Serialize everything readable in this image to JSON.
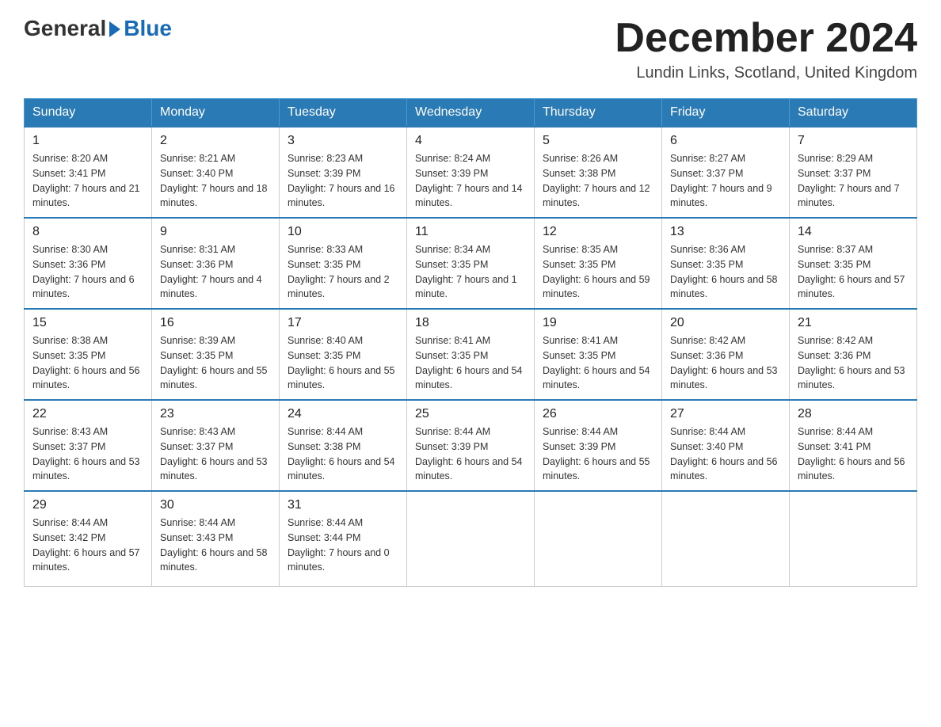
{
  "header": {
    "logo_general": "General",
    "logo_blue": "Blue",
    "title": "December 2024",
    "location": "Lundin Links, Scotland, United Kingdom"
  },
  "weekdays": [
    "Sunday",
    "Monday",
    "Tuesday",
    "Wednesday",
    "Thursday",
    "Friday",
    "Saturday"
  ],
  "weeks": [
    [
      {
        "day": "1",
        "sunrise": "8:20 AM",
        "sunset": "3:41 PM",
        "daylight": "7 hours and 21 minutes."
      },
      {
        "day": "2",
        "sunrise": "8:21 AM",
        "sunset": "3:40 PM",
        "daylight": "7 hours and 18 minutes."
      },
      {
        "day": "3",
        "sunrise": "8:23 AM",
        "sunset": "3:39 PM",
        "daylight": "7 hours and 16 minutes."
      },
      {
        "day": "4",
        "sunrise": "8:24 AM",
        "sunset": "3:39 PM",
        "daylight": "7 hours and 14 minutes."
      },
      {
        "day": "5",
        "sunrise": "8:26 AM",
        "sunset": "3:38 PM",
        "daylight": "7 hours and 12 minutes."
      },
      {
        "day": "6",
        "sunrise": "8:27 AM",
        "sunset": "3:37 PM",
        "daylight": "7 hours and 9 minutes."
      },
      {
        "day": "7",
        "sunrise": "8:29 AM",
        "sunset": "3:37 PM",
        "daylight": "7 hours and 7 minutes."
      }
    ],
    [
      {
        "day": "8",
        "sunrise": "8:30 AM",
        "sunset": "3:36 PM",
        "daylight": "7 hours and 6 minutes."
      },
      {
        "day": "9",
        "sunrise": "8:31 AM",
        "sunset": "3:36 PM",
        "daylight": "7 hours and 4 minutes."
      },
      {
        "day": "10",
        "sunrise": "8:33 AM",
        "sunset": "3:35 PM",
        "daylight": "7 hours and 2 minutes."
      },
      {
        "day": "11",
        "sunrise": "8:34 AM",
        "sunset": "3:35 PM",
        "daylight": "7 hours and 1 minute."
      },
      {
        "day": "12",
        "sunrise": "8:35 AM",
        "sunset": "3:35 PM",
        "daylight": "6 hours and 59 minutes."
      },
      {
        "day": "13",
        "sunrise": "8:36 AM",
        "sunset": "3:35 PM",
        "daylight": "6 hours and 58 minutes."
      },
      {
        "day": "14",
        "sunrise": "8:37 AM",
        "sunset": "3:35 PM",
        "daylight": "6 hours and 57 minutes."
      }
    ],
    [
      {
        "day": "15",
        "sunrise": "8:38 AM",
        "sunset": "3:35 PM",
        "daylight": "6 hours and 56 minutes."
      },
      {
        "day": "16",
        "sunrise": "8:39 AM",
        "sunset": "3:35 PM",
        "daylight": "6 hours and 55 minutes."
      },
      {
        "day": "17",
        "sunrise": "8:40 AM",
        "sunset": "3:35 PM",
        "daylight": "6 hours and 55 minutes."
      },
      {
        "day": "18",
        "sunrise": "8:41 AM",
        "sunset": "3:35 PM",
        "daylight": "6 hours and 54 minutes."
      },
      {
        "day": "19",
        "sunrise": "8:41 AM",
        "sunset": "3:35 PM",
        "daylight": "6 hours and 54 minutes."
      },
      {
        "day": "20",
        "sunrise": "8:42 AM",
        "sunset": "3:36 PM",
        "daylight": "6 hours and 53 minutes."
      },
      {
        "day": "21",
        "sunrise": "8:42 AM",
        "sunset": "3:36 PM",
        "daylight": "6 hours and 53 minutes."
      }
    ],
    [
      {
        "day": "22",
        "sunrise": "8:43 AM",
        "sunset": "3:37 PM",
        "daylight": "6 hours and 53 minutes."
      },
      {
        "day": "23",
        "sunrise": "8:43 AM",
        "sunset": "3:37 PM",
        "daylight": "6 hours and 53 minutes."
      },
      {
        "day": "24",
        "sunrise": "8:44 AM",
        "sunset": "3:38 PM",
        "daylight": "6 hours and 54 minutes."
      },
      {
        "day": "25",
        "sunrise": "8:44 AM",
        "sunset": "3:39 PM",
        "daylight": "6 hours and 54 minutes."
      },
      {
        "day": "26",
        "sunrise": "8:44 AM",
        "sunset": "3:39 PM",
        "daylight": "6 hours and 55 minutes."
      },
      {
        "day": "27",
        "sunrise": "8:44 AM",
        "sunset": "3:40 PM",
        "daylight": "6 hours and 56 minutes."
      },
      {
        "day": "28",
        "sunrise": "8:44 AM",
        "sunset": "3:41 PM",
        "daylight": "6 hours and 56 minutes."
      }
    ],
    [
      {
        "day": "29",
        "sunrise": "8:44 AM",
        "sunset": "3:42 PM",
        "daylight": "6 hours and 57 minutes."
      },
      {
        "day": "30",
        "sunrise": "8:44 AM",
        "sunset": "3:43 PM",
        "daylight": "6 hours and 58 minutes."
      },
      {
        "day": "31",
        "sunrise": "8:44 AM",
        "sunset": "3:44 PM",
        "daylight": "7 hours and 0 minutes."
      },
      null,
      null,
      null,
      null
    ]
  ]
}
